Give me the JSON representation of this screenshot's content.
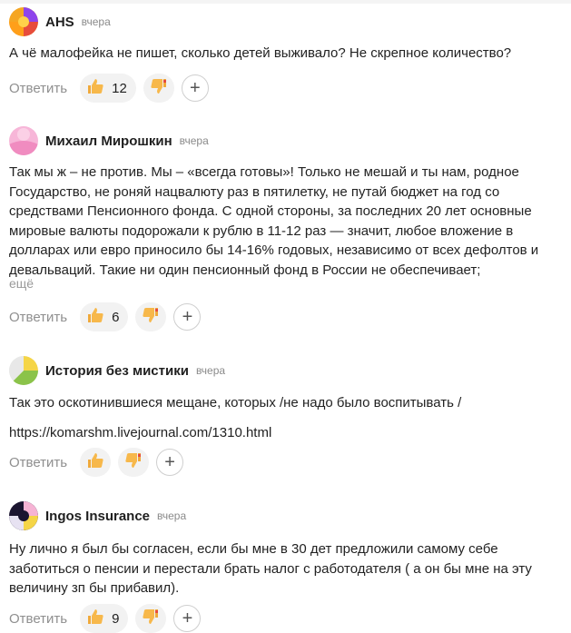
{
  "reply_label": "Ответить",
  "more_label": "ещё",
  "comments": [
    {
      "author": "AHS",
      "time": "вчера",
      "lines": [
        "А чё малофейка не пишет, сколько детей выживало? Не скрепное количество?"
      ],
      "likes": "12"
    },
    {
      "author": "Михаил Мирошкин",
      "time": "вчера",
      "lines": [
        "Так мы ж – не против. Мы – «всегда готовы»! Только не мешай и ты нам, родное",
        "Государство, не роняй нацвалюту раз в пятилетку, не путай бюджет на год со",
        "средствами Пенсионного фонда. С одной стороны, за последних 20 лет основные",
        "мировые валюты подорожали к рублю в 11-12 раз — значит, любое вложение в",
        "долларах или евро приносило бы 14-16% годовых, независимо от всех дефолтов и",
        "девальваций. Такие ни один пенсионный фонд в России не обеспечивает;"
      ],
      "likes": "6"
    },
    {
      "author": "История без мистики",
      "time": "вчера",
      "lines": [
        "Так это оскотинившиеся мещане, которых /не надо было воспитывать /",
        "https://komarshm.livejournal.com/1310.html"
      ],
      "likes": ""
    },
    {
      "author": "Ingos Insurance",
      "time": "вчера",
      "lines": [
        "Ну лично я был бы согласен, если бы мне в 30 дет предложили самому себе",
        "заботиться о пенсии и перестали брать налог с работодателя ( а он бы мне на эту",
        "величину зп бы прибавил)."
      ],
      "likes": "9"
    }
  ]
}
